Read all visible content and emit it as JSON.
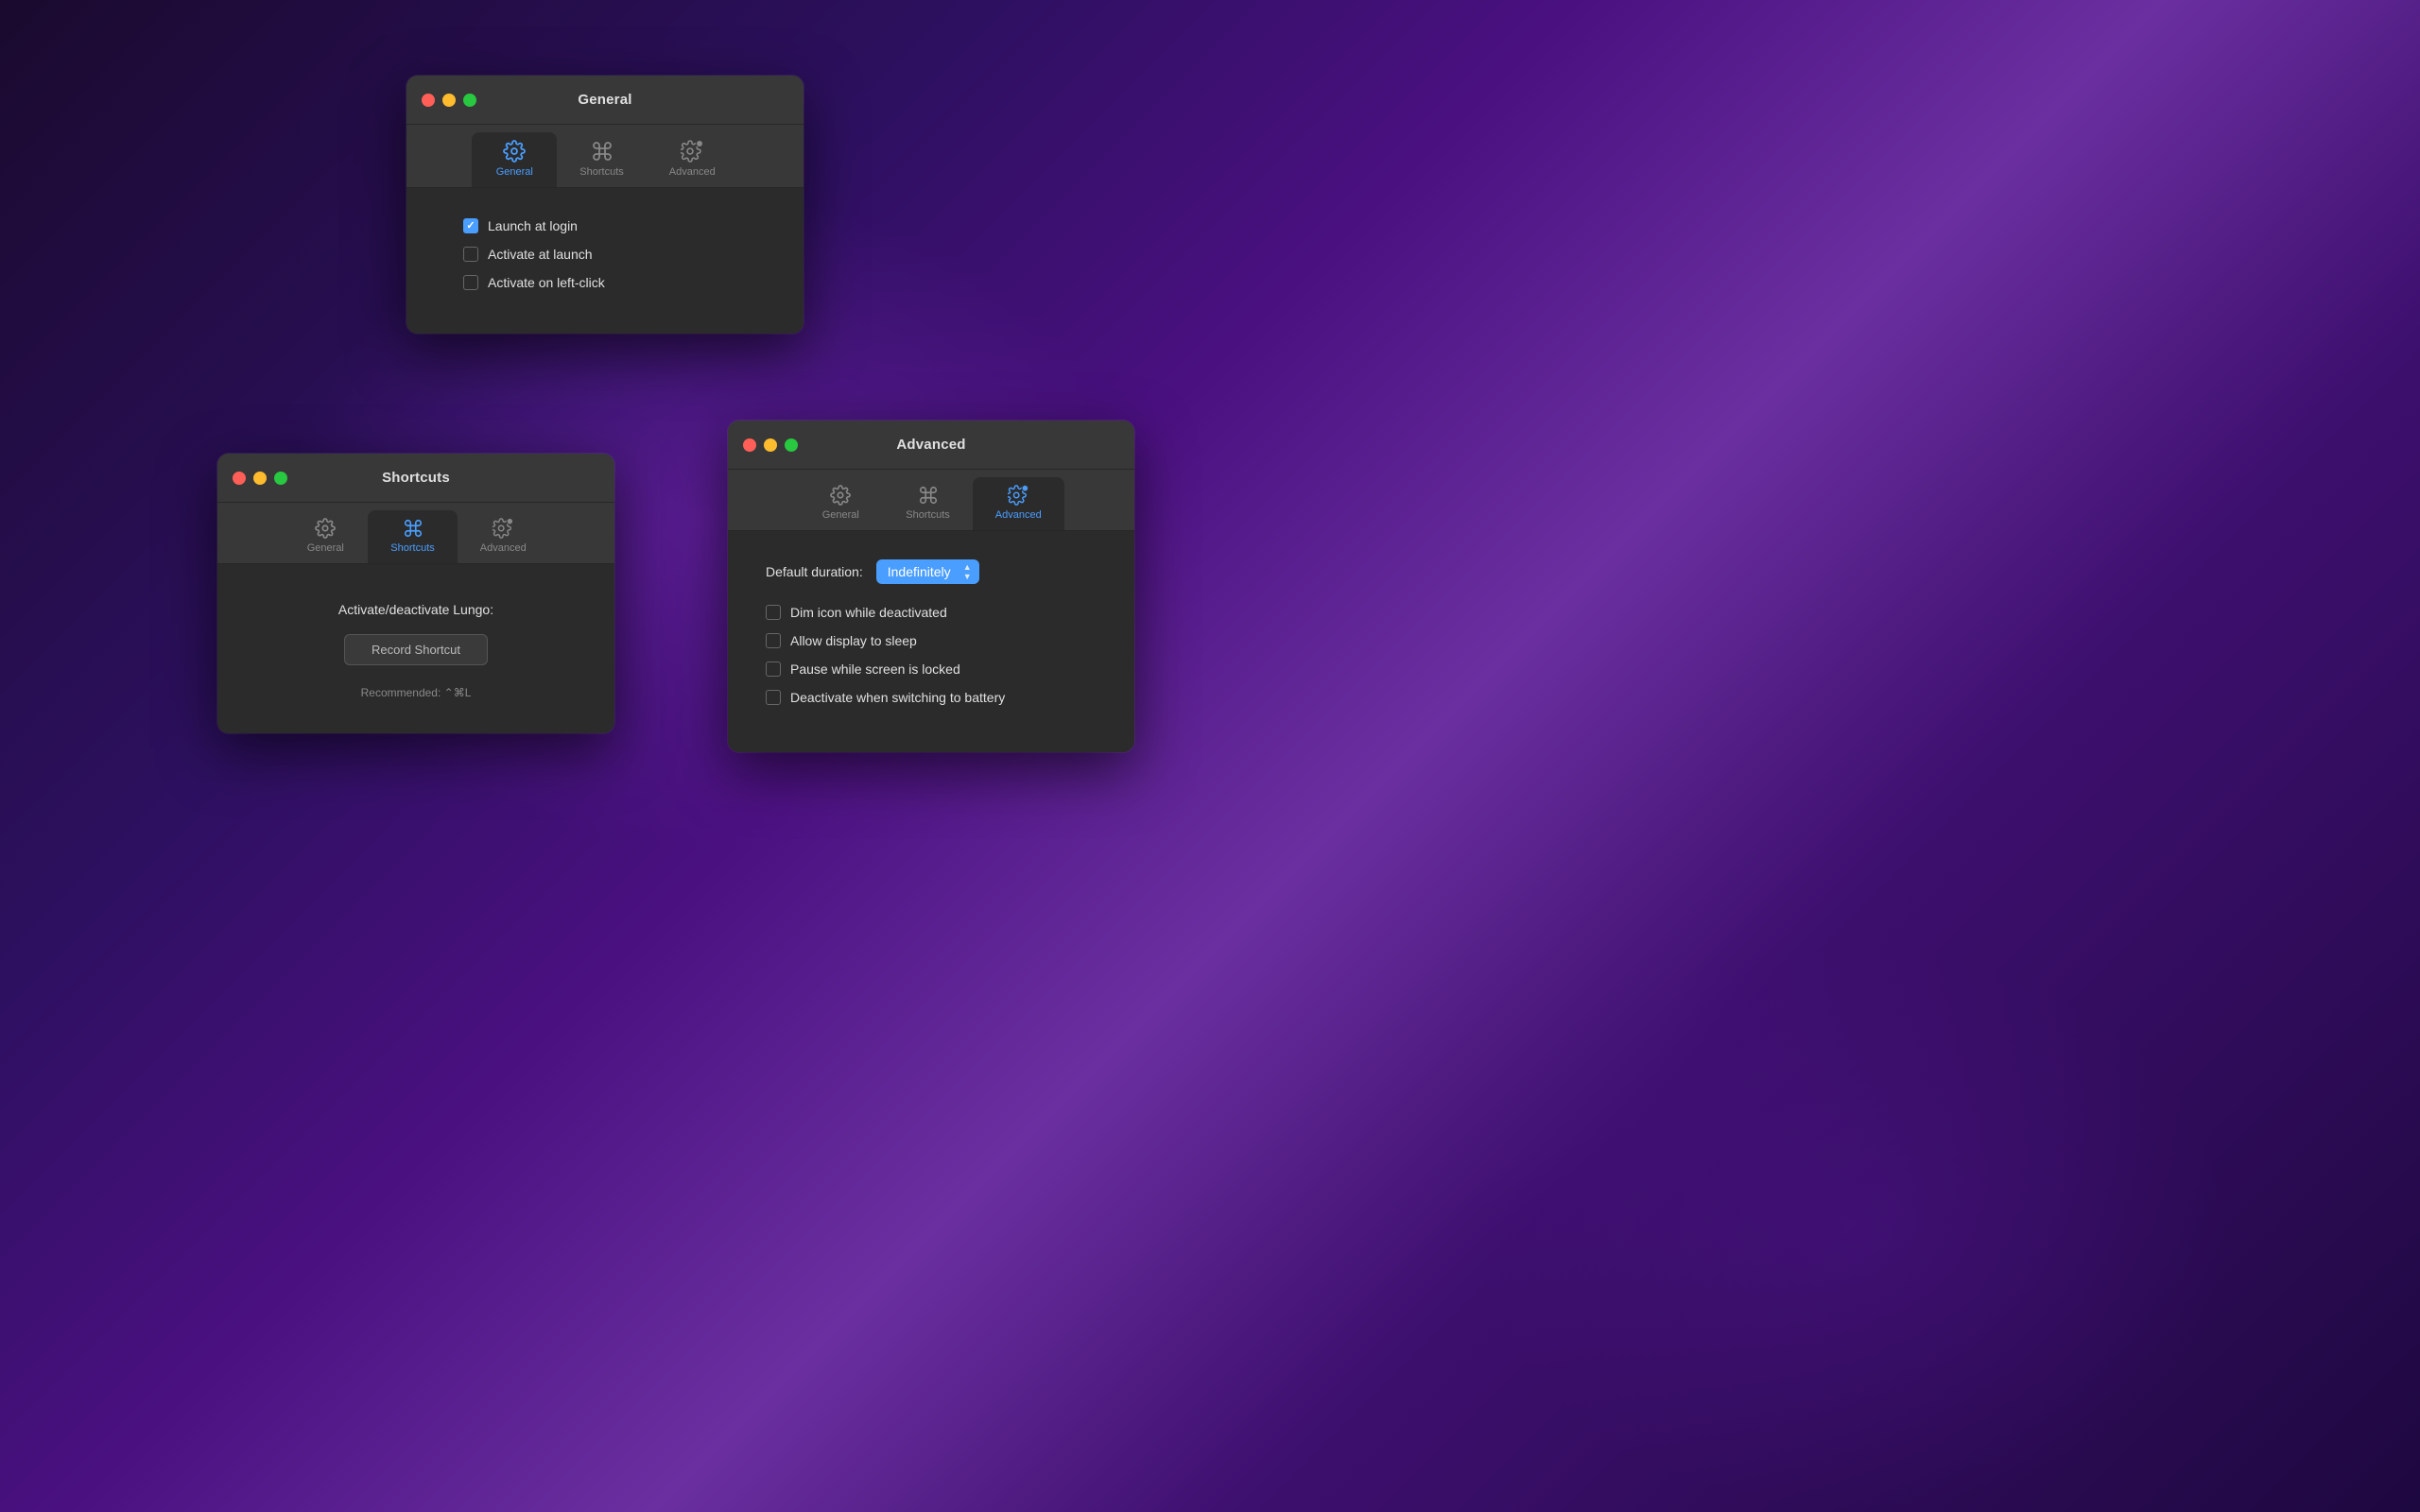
{
  "background": {
    "description": "macOS Big Sur purple gradient desktop"
  },
  "general_window": {
    "title": "General",
    "traffic_lights": {
      "close": "close",
      "minimize": "minimize",
      "maximize": "maximize"
    },
    "tabs": [
      {
        "id": "general",
        "label": "General",
        "icon": "gear",
        "active": true
      },
      {
        "id": "shortcuts",
        "label": "Shortcuts",
        "icon": "command",
        "active": false
      },
      {
        "id": "advanced",
        "label": "Advanced",
        "icon": "gear-badge",
        "active": false
      }
    ],
    "checkboxes": [
      {
        "id": "launch-login",
        "label": "Launch at login",
        "checked": true
      },
      {
        "id": "activate-launch",
        "label": "Activate at launch",
        "checked": false
      },
      {
        "id": "activate-left-click",
        "label": "Activate on left-click",
        "checked": false
      }
    ]
  },
  "shortcuts_window": {
    "title": "Shortcuts",
    "tabs": [
      {
        "id": "general",
        "label": "General",
        "icon": "gear",
        "active": false
      },
      {
        "id": "shortcuts",
        "label": "Shortcuts",
        "icon": "command",
        "active": true
      },
      {
        "id": "advanced",
        "label": "Advanced",
        "icon": "gear-badge",
        "active": false
      }
    ],
    "activate_label": "Activate/deactivate Lungo:",
    "record_button": "Record Shortcut",
    "recommended_text": "Recommended: ⌃⌘L"
  },
  "advanced_window": {
    "title": "Advanced",
    "tabs": [
      {
        "id": "general",
        "label": "General",
        "icon": "gear",
        "active": false
      },
      {
        "id": "shortcuts",
        "label": "Shortcuts",
        "icon": "command",
        "active": false
      },
      {
        "id": "advanced",
        "label": "Advanced",
        "icon": "gear-badge",
        "active": true
      }
    ],
    "duration_label": "Default duration:",
    "duration_value": "Indefinitely",
    "checkboxes": [
      {
        "id": "dim-icon",
        "label": "Dim icon while deactivated",
        "checked": false
      },
      {
        "id": "allow-sleep",
        "label": "Allow display to sleep",
        "checked": false
      },
      {
        "id": "pause-locked",
        "label": "Pause while screen is locked",
        "checked": false
      },
      {
        "id": "deactivate-battery",
        "label": "Deactivate when switching to battery",
        "checked": false
      }
    ]
  }
}
